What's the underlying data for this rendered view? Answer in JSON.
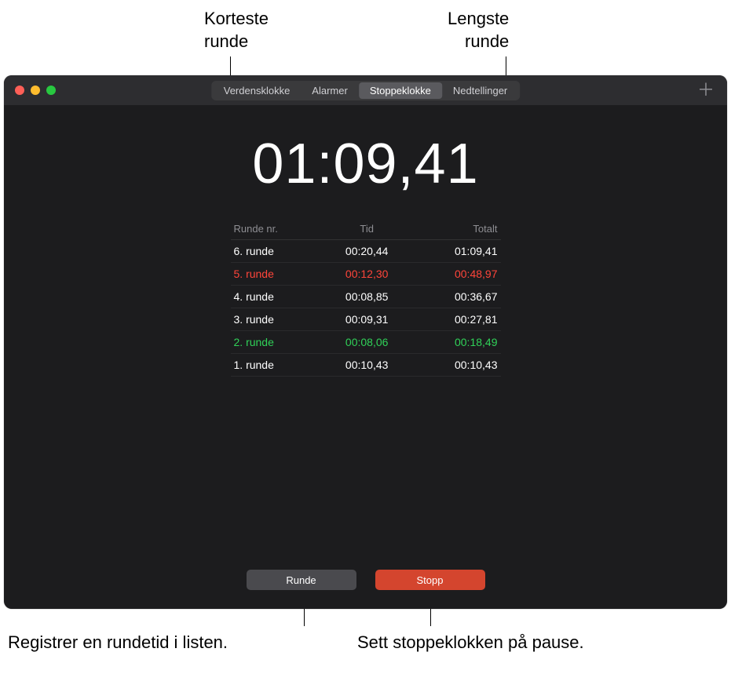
{
  "callouts": {
    "shortest": "Korteste\nrunde",
    "longest": "Lengste\nrunde",
    "lap_hint": "Registrer en rundetid i listen.",
    "stop_hint": "Sett stoppeklokken på pause."
  },
  "window": {
    "tabs": [
      "Verdensklokke",
      "Alarmer",
      "Stoppeklokke",
      "Nedtellinger"
    ],
    "active_tab_index": 2,
    "add_icon_glyph": "＋"
  },
  "stopwatch": {
    "time": "01:09,41",
    "headers": {
      "lap": "Runde nr.",
      "time": "Tid",
      "total": "Totalt"
    },
    "laps": [
      {
        "label": "6. runde",
        "time": "00:20,44",
        "total": "01:09,41",
        "type": "normal"
      },
      {
        "label": "5. runde",
        "time": "00:12,30",
        "total": "00:48,97",
        "type": "longest"
      },
      {
        "label": "4. runde",
        "time": "00:08,85",
        "total": "00:36,67",
        "type": "normal"
      },
      {
        "label": "3. runde",
        "time": "00:09,31",
        "total": "00:27,81",
        "type": "normal"
      },
      {
        "label": "2. runde",
        "time": "00:08,06",
        "total": "00:18,49",
        "type": "shortest"
      },
      {
        "label": "1. runde",
        "time": "00:10,43",
        "total": "00:10,43",
        "type": "normal"
      }
    ],
    "buttons": {
      "lap": "Runde",
      "stop": "Stopp"
    }
  }
}
